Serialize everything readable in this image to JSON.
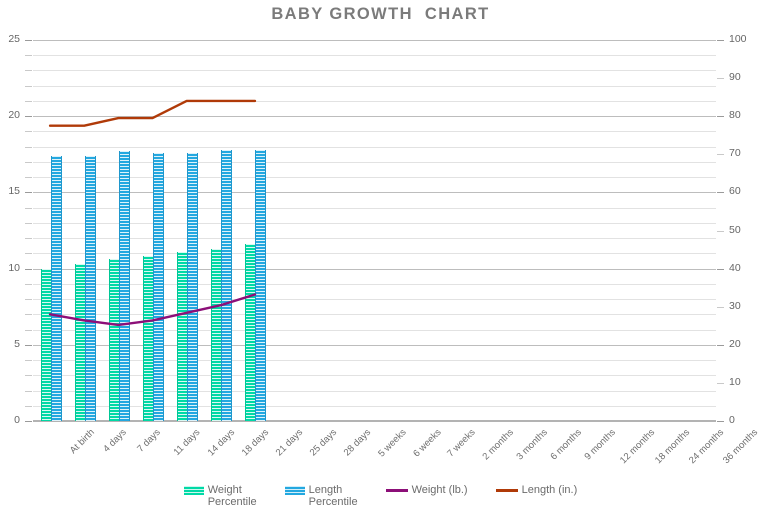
{
  "chart_data": {
    "type": "bar",
    "title": "BABY GROWTH  CHART",
    "xlabel": "",
    "ylabel": "",
    "grid": true,
    "legend_position": "bottom",
    "categories": [
      "At birth",
      "4 days",
      "7 days",
      "11 days",
      "14 days",
      "18 days",
      "21 days",
      "25 days",
      "28 days",
      "5 weeks",
      "6 weeks",
      "7 weeks",
      "2 months",
      "3 months",
      "6 months",
      "9 months",
      "12 months",
      "18 months",
      "24 months",
      "36 months"
    ],
    "left_axis": {
      "min": 0,
      "max": 25,
      "major_step": 5,
      "minor_step": 1,
      "ticks": [
        0,
        5,
        10,
        15,
        20,
        25
      ]
    },
    "right_axis": {
      "min": 0,
      "max": 100,
      "major_step": 20,
      "minor_step": 10,
      "ticks": [
        0,
        10,
        20,
        30,
        40,
        50,
        60,
        70,
        80,
        90,
        100
      ]
    },
    "series": [
      {
        "name": "Weight Percentile",
        "legend_label": "Weight\nPercentile",
        "render": "bar",
        "axis": "left",
        "color": "#00d9a6",
        "values": [
          10.0,
          10.3,
          10.6,
          10.8,
          11.1,
          11.3,
          11.6,
          null,
          null,
          null,
          null,
          null,
          null,
          null,
          null,
          null,
          null,
          null,
          null,
          null
        ]
      },
      {
        "name": "Length Percentile",
        "legend_label": "Length\nPercentile",
        "render": "bar",
        "axis": "left",
        "color": "#23a8e0",
        "values": [
          17.4,
          17.4,
          17.7,
          17.6,
          17.6,
          17.8,
          17.8,
          null,
          null,
          null,
          null,
          null,
          null,
          null,
          null,
          null,
          null,
          null,
          null,
          null
        ]
      },
      {
        "name": "Weight (lb.)",
        "legend_label": "Weight (lb.)",
        "render": "line",
        "axis": "left",
        "color": "#8c0f78",
        "values": [
          7.0,
          6.6,
          6.3,
          6.6,
          7.1,
          7.6,
          8.3,
          null,
          null,
          null,
          null,
          null,
          null,
          null,
          null,
          null,
          null,
          null,
          null,
          null
        ]
      },
      {
        "name": "Length (in.)",
        "legend_label": "Length (in.)",
        "render": "line",
        "axis": "right",
        "color": "#b03a08",
        "values": [
          77.5,
          77.5,
          79.5,
          79.5,
          84.0,
          84.0,
          84.0,
          null,
          null,
          null,
          null,
          null,
          null,
          null,
          null,
          null,
          null,
          null,
          null,
          null
        ]
      }
    ]
  },
  "legend": {
    "items": [
      {
        "label": "Weight\nPercentile",
        "type": "bar",
        "color": "#00d9a6"
      },
      {
        "label": "Length\nPercentile",
        "type": "bar",
        "color": "#23a8e0"
      },
      {
        "label": "Weight (lb.)",
        "type": "line",
        "color": "#8c0f78"
      },
      {
        "label": "Length (in.)",
        "type": "line",
        "color": "#b03a08"
      }
    ]
  }
}
